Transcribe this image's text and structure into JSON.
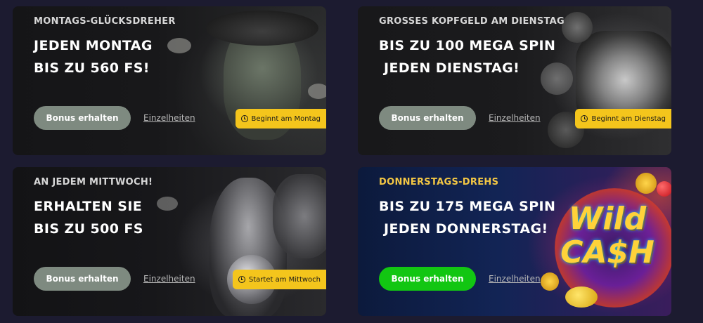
{
  "promotions": [
    {
      "kicker": "MONTAGS-GLÜCKSDREHER",
      "headline": "JEDEN MONTAG\nBIS ZU 560 FS!",
      "button": "Bonus erhalten",
      "details": "Einzelheiten",
      "badge": "Beginnt am Montag",
      "badge_icon": "clock-icon",
      "button_color": "#7e8a80",
      "kicker_color": "#d7d7d7"
    },
    {
      "kicker": "GROSSES KOPFGELD AM DIENSTAG",
      "headline": "BIS ZU 100 MEGA SPIN\n JEDEN DIENSTAG!",
      "button": "Bonus erhalten",
      "details": "Einzelheiten",
      "badge": "Beginnt am Dienstag",
      "badge_icon": "clock-icon",
      "button_color": "#7e8a80",
      "kicker_color": "#d7d7d7"
    },
    {
      "kicker": "AN JEDEM MITTWOCH!",
      "headline": "ERHALTEN SIE\nBIS ZU 500 FS",
      "button": "Bonus erhalten",
      "details": "Einzelheiten",
      "badge": "Startet am Mittwoch",
      "badge_icon": "clock-icon",
      "button_color": "#7e8a80",
      "kicker_color": "#d7d7d7"
    },
    {
      "kicker": "DONNERSTAGS-DREHS",
      "headline": "BIS ZU 175 MEGA SPIN\n JEDEN DONNERSTAG!",
      "button": "Bonus erhalten",
      "details": "Einzelheiten",
      "logo": "Wild CA$H",
      "button_color": "#12c612",
      "kicker_color": "#f3c744"
    }
  ],
  "colors": {
    "badge": "#f4c51c",
    "page_background": "#1c1b30"
  }
}
